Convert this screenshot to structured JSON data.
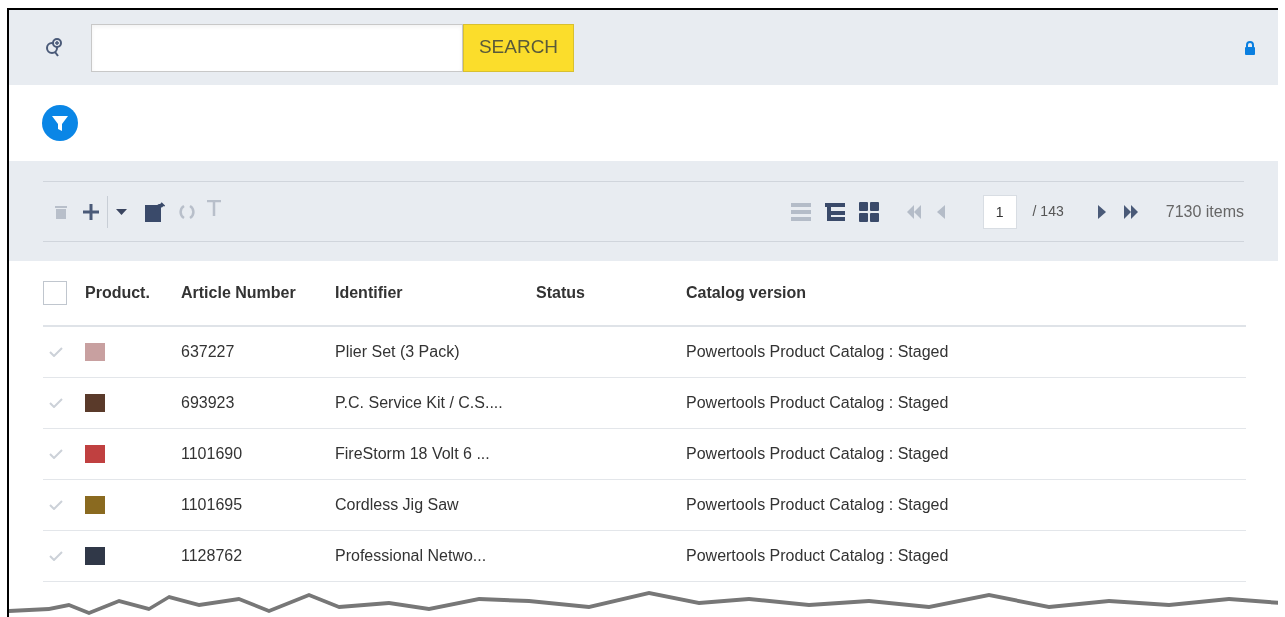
{
  "search": {
    "button": "SEARCH"
  },
  "pagination": {
    "page": "1",
    "total": "/ 143",
    "count": "7130 items"
  },
  "table": {
    "select_all": {
      "checked": false
    },
    "columns": [
      "Product.",
      "Article Number",
      "Identifier",
      "Status",
      "Catalog version"
    ],
    "rows": [
      {
        "article_number": "637227",
        "identifier": "Plier Set (3 Pack)",
        "catalog_version": "Powertools Product Catalog : Staged"
      },
      {
        "article_number": "693923",
        "identifier": "P.C. Service Kit / C.S....",
        "catalog_version": "Powertools Product Catalog : Staged"
      },
      {
        "article_number": "1101690",
        "identifier": "FireStorm 18 Volt 6 ...",
        "catalog_version": "Powertools Product Catalog : Staged"
      },
      {
        "article_number": "1101695",
        "identifier": "Cordless Jig Saw",
        "catalog_version": "Powertools Product Catalog : Staged"
      },
      {
        "article_number": "1128762",
        "identifier": "Professional Netwo...",
        "catalog_version": "Powertools Product Catalog : Staged"
      }
    ]
  }
}
